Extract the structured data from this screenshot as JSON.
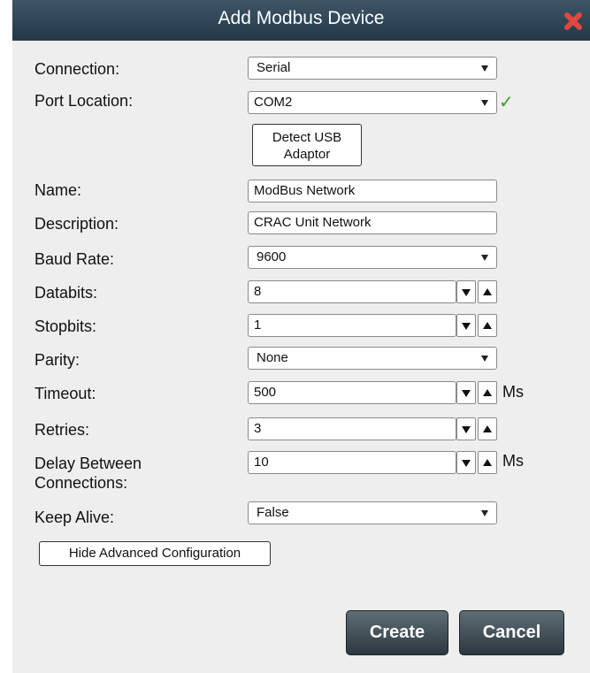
{
  "dialog": {
    "title": "Add Modbus Device",
    "close_icon": "close-icon",
    "colors": {
      "titlebar": "#2e4556",
      "close": "#e0473f",
      "check": "#3a9a2a",
      "button": "#3c4a52"
    }
  },
  "form": {
    "connection": {
      "label": "Connection:",
      "value": "Serial"
    },
    "port_location": {
      "label": "Port Location:",
      "value": "COM2",
      "status_icon": "check-icon"
    },
    "detect_usb": {
      "label_line1": "Detect USB",
      "label_line2": "Adaptor"
    },
    "name": {
      "label": "Name:",
      "value": "ModBus Network"
    },
    "description": {
      "label": "Description:",
      "value": "CRAC Unit Network"
    },
    "baud_rate": {
      "label": "Baud Rate:",
      "value": "9600"
    },
    "databits": {
      "label": "Databits:",
      "value": "8"
    },
    "stopbits": {
      "label": "Stopbits:",
      "value": "1"
    },
    "parity": {
      "label": "Parity:",
      "value": "None"
    },
    "timeout": {
      "label": "Timeout:",
      "value": "500",
      "unit": "Ms"
    },
    "retries": {
      "label": "Retries:",
      "value": "3"
    },
    "delay": {
      "label_line1": "Delay Between",
      "label_line2": "Connections:",
      "value": "10",
      "unit": "Ms"
    },
    "keep_alive": {
      "label": "Keep Alive:",
      "value": "False"
    }
  },
  "actions": {
    "advanced": "Hide Advanced Configuration",
    "create": "Create",
    "cancel": "Cancel"
  }
}
